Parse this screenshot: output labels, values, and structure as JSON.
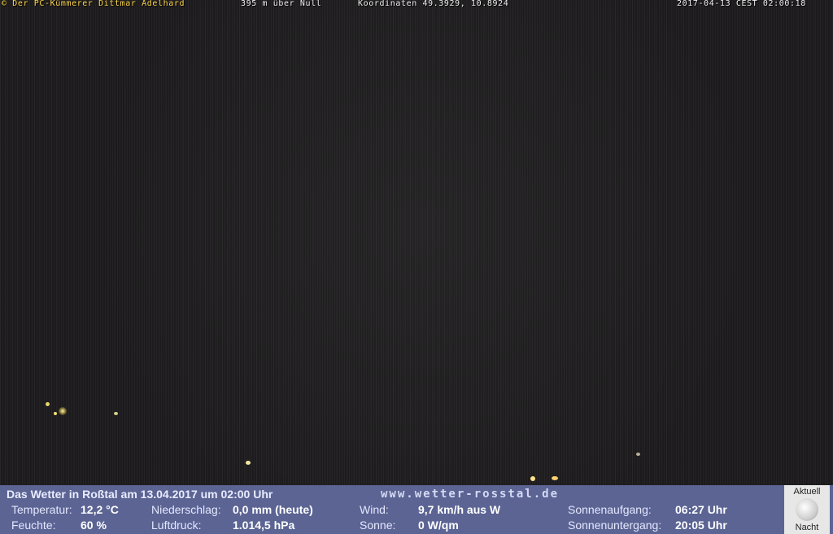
{
  "overlay": {
    "copyright": "© Der PC-Kümmerer Dittmar Adelhard",
    "altitude": "395 m über Null",
    "coordinates": "Koordinaten 49.3929, 10.8924",
    "datetime": "2017-04-13 CEST 02:00:18"
  },
  "footer": {
    "title": "Das Wetter in Roßtal am 13.04.2017 um 02:00 Uhr",
    "site": "www.wetter-rosstal.de",
    "temperature": {
      "label": "Temperatur:",
      "value": "12,2 °C"
    },
    "humidity": {
      "label": "Feuchte:",
      "value": "60 %"
    },
    "precipitation": {
      "label": "Niederschlag:",
      "value": "0,0 mm (heute)"
    },
    "pressure": {
      "label": "Luftdruck:",
      "value": "1.014,5 hPa"
    },
    "wind": {
      "label": "Wind:",
      "value": "9,7 km/h aus W"
    },
    "sun": {
      "label": "Sonne:",
      "value": "0 W/qm"
    },
    "sunrise": {
      "label": "Sonnenaufgang:",
      "value": "06:27 Uhr"
    },
    "sunset": {
      "label": "Sonnenuntergang:",
      "value": "20:05 Uhr"
    },
    "moon": {
      "top": "Aktuell",
      "bottom": "Nacht",
      "icon": "moon-icon"
    }
  },
  "colors": {
    "overlay_yellow": "#ffd84a",
    "footer_bg": "#5b6493"
  }
}
